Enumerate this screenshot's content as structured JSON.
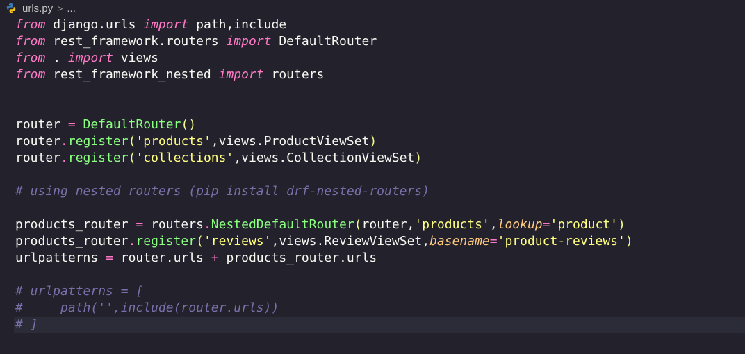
{
  "breadcrumb": {
    "file_name": "urls.py",
    "separator": ">",
    "ellipsis": "..."
  },
  "code": {
    "l1": [
      "from",
      " django.urls ",
      "import",
      " path,include"
    ],
    "l2": [
      "from",
      " rest_framework.routers ",
      "import",
      " DefaultRouter"
    ],
    "l3": [
      "from",
      " . ",
      "import",
      " views"
    ],
    "l4": [
      "from",
      " rest_framework_nested ",
      "import",
      " routers"
    ],
    "l7": [
      "router ",
      "=",
      " ",
      "DefaultRouter",
      "()"
    ],
    "l8": [
      "router",
      ".",
      "register",
      "(",
      "'products'",
      ",views.ProductViewSet",
      ")"
    ],
    "l9": [
      "router",
      ".",
      "register",
      "(",
      "'collections'",
      ",views.CollectionViewSet",
      ")"
    ],
    "l11": "# using nested routers (pip install drf-nested-routers)",
    "l13": [
      "products_router ",
      "=",
      " routers",
      ".",
      "NestedDefaultRouter",
      "(",
      "router,",
      "'products'",
      ",",
      "lookup",
      "=",
      "'product'",
      ")"
    ],
    "l14": [
      "products_router",
      ".",
      "register",
      "(",
      "'reviews'",
      ",views.ReviewViewSet,",
      "basename",
      "=",
      "'product-reviews'",
      ")"
    ],
    "l15": [
      "urlpatterns ",
      "=",
      " router.urls ",
      "+",
      " products_router.urls"
    ],
    "l17": "# urlpatterns = [",
    "l18": "#     path('',include(router.urls))",
    "l19": "# ]"
  }
}
